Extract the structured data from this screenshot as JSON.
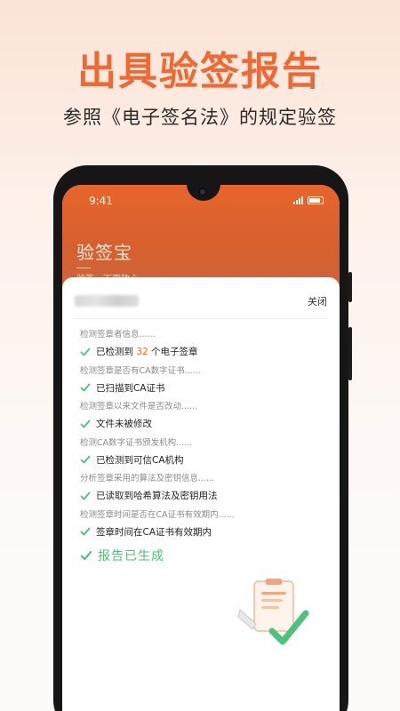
{
  "hero": {
    "title": "出具验签报告",
    "subtitle": "参照《电子签名法》的规定验签"
  },
  "status_bar": {
    "time": "9:41"
  },
  "app": {
    "title": "验签宝",
    "slogan": "验签，下更放心"
  },
  "sheet": {
    "close_label": "关闭",
    "steps": [
      {
        "desc": "检测签章者信息......",
        "result_prefix": "已检测到 ",
        "result_count": "32",
        "result_suffix": " 个电子签章"
      },
      {
        "desc": "检测签章是否有CA数字证书......",
        "result": "已扫描到CA证书"
      },
      {
        "desc": "检测签章以来文件是否改动......",
        "result": "文件未被修改"
      },
      {
        "desc": "检测CA数字证书颁发机构......",
        "result": "已检测到可信CA机构"
      },
      {
        "desc": "分析签章采用的算法及密钥信息......",
        "result": "已读取到哈希算法及密钥用法"
      },
      {
        "desc": "检测签章时间是否在CA证书有效期内......",
        "result": "签章时间在CA证书有效期内"
      }
    ],
    "completed_label": "报告已生成"
  },
  "colors": {
    "accent": "#ee6a35",
    "header_orange": "#e8652c",
    "success_green": "#4cc27a"
  },
  "icons": [
    "check-icon",
    "report-document-icon",
    "battery-icon",
    "signal-icon",
    "camera-icon"
  ]
}
